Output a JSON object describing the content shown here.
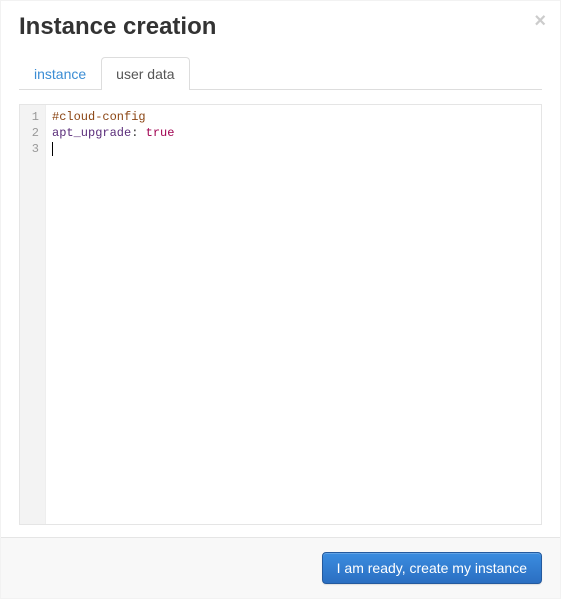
{
  "header": {
    "title": "Instance creation",
    "close_label": "×"
  },
  "tabs": {
    "instance": {
      "label": "instance"
    },
    "user_data": {
      "label": "user data"
    },
    "active": "user_data"
  },
  "editor": {
    "gutter": [
      "1",
      "2",
      "3"
    ],
    "lines": [
      {
        "tokens": [
          {
            "cls": "tok-comment",
            "text": "#cloud-config"
          }
        ]
      },
      {
        "tokens": [
          {
            "cls": "tok-key",
            "text": "apt_upgrade"
          },
          {
            "cls": "tok-punct",
            "text": ": "
          },
          {
            "cls": "tok-bool",
            "text": "true"
          }
        ]
      },
      {
        "tokens": [],
        "cursor": true
      }
    ]
  },
  "footer": {
    "submit_label": "I am ready, create my instance"
  }
}
